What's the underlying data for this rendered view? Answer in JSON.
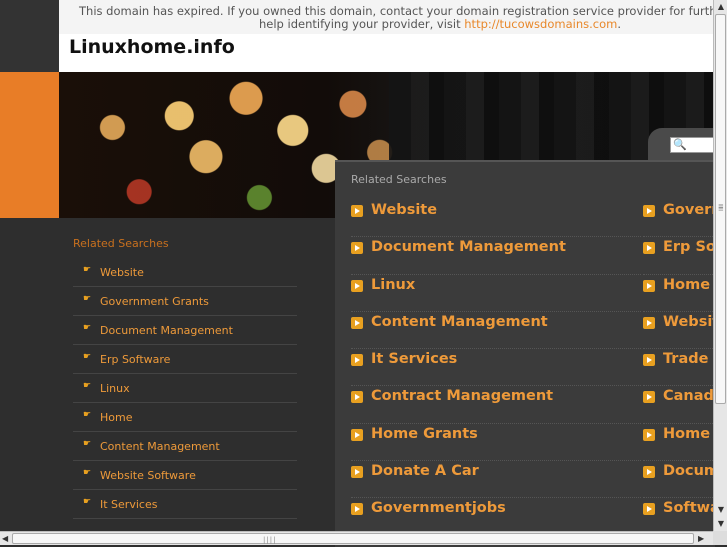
{
  "notice": {
    "line1": "This domain has expired. If you owned this domain, contact your domain registration service provider for further assistance. If you",
    "line2": "help identifying your provider, visit ",
    "link": "http://tucowsdomains.com",
    "end": "."
  },
  "site": {
    "title": "Linuxhome.info"
  },
  "search": {
    "placeholder": ""
  },
  "left_panel": {
    "heading": "Related Searches",
    "items": [
      "Website",
      "Government Grants",
      "Document Management",
      "Erp Software",
      "Linux",
      "Home",
      "Content Management",
      "Website Software",
      "It Services"
    ]
  },
  "right_panel": {
    "heading": "Related Searches",
    "col1": [
      "Website",
      "Document Management",
      "Linux",
      "Content Management",
      "It Services",
      "Contract Management",
      "Home Grants",
      "Donate A Car",
      "Governmentjobs"
    ],
    "col2": [
      "Govern",
      "Erp Sof",
      "Home",
      "Website",
      "Trade",
      "Canada",
      "Home G",
      "Docum",
      "Softwa"
    ]
  },
  "colors": {
    "accent": "#e87d27",
    "link": "#ee9a3a",
    "background": "#2e2e2e"
  }
}
